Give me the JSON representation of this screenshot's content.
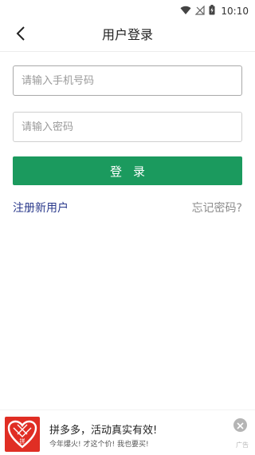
{
  "status_bar": {
    "time": "10:10",
    "icons": [
      "wifi-icon",
      "no-signal-icon",
      "battery-charging-icon"
    ]
  },
  "header": {
    "title": "用户登录",
    "back_icon": "chevron-left-icon"
  },
  "form": {
    "phone_placeholder": "请输入手机号码",
    "phone_value": "",
    "password_placeholder": "请输入密码",
    "password_value": "",
    "login_label": "登录"
  },
  "links": {
    "register": "注册新用户",
    "forgot_password": "忘记密码?"
  },
  "ad": {
    "title": "拼多多，活动真实有效!",
    "subtitle": "今年爆火! 才这个价! 我也要买!",
    "tag": "广告",
    "logo_text": "拼"
  },
  "colors": {
    "primary": "#1b9a5e",
    "link": "#2b3a8c",
    "ad_brand": "#e02e24"
  }
}
